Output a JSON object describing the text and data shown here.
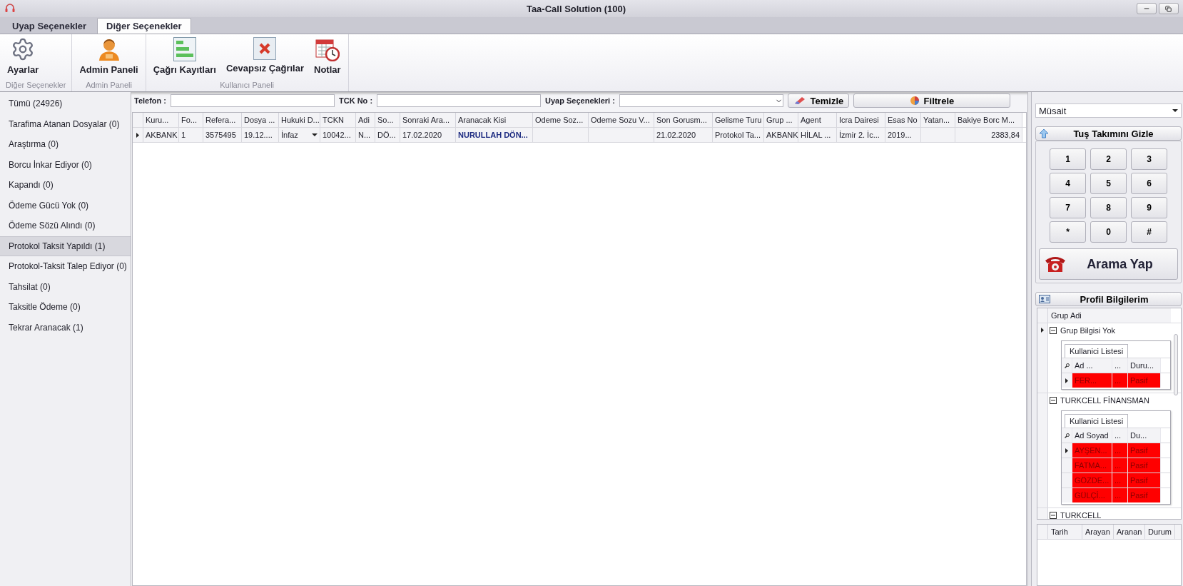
{
  "window": {
    "title": "Taa-Call Solution (100)"
  },
  "ribbon": {
    "tabs": [
      {
        "label": "Uyap Seçenekler",
        "selected": false
      },
      {
        "label": "Diğer Seçenekler",
        "selected": true
      }
    ],
    "groups": [
      {
        "label": "Diğer Seçenekler",
        "buttons": [
          {
            "label": "Ayarlar",
            "kind": "gear"
          }
        ]
      },
      {
        "label": "Admin Paneli",
        "buttons": [
          {
            "label": "Admin Paneli",
            "kind": "admin"
          }
        ]
      },
      {
        "label": "Kullanıcı Paneli",
        "buttons": [
          {
            "label": "Çağrı Kayıtları",
            "kind": "records"
          },
          {
            "label": "Cevapsız Çağrılar",
            "kind": "missed"
          },
          {
            "label": "Notlar",
            "kind": "notes"
          }
        ]
      }
    ]
  },
  "filters": {
    "fields": [
      {
        "label": "Telefon :",
        "kind": "text"
      },
      {
        "label": "TCK No :",
        "kind": "text"
      },
      {
        "label": "Uyap Seçenekleri :",
        "kind": "select"
      }
    ],
    "buttons": [
      {
        "label": "Temizle",
        "kind": "eraser"
      },
      {
        "label": "Filtrele",
        "kind": "filter"
      }
    ]
  },
  "sidebar": {
    "items": [
      {
        "label": "Tümü (24926)",
        "selected": false
      },
      {
        "label": "Tarafima Atanan Dosyalar (0)",
        "selected": false
      },
      {
        "label": "Araştırma (0)",
        "selected": false
      },
      {
        "label": "Borcu İnkar Ediyor (0)",
        "selected": false
      },
      {
        "label": "Kapandı (0)",
        "selected": false
      },
      {
        "label": "Ödeme Gücü Yok (0)",
        "selected": false
      },
      {
        "label": "Ödeme Sözü Alındı (0)",
        "selected": false
      },
      {
        "label": "Protokol Taksit Yapıldı (1)",
        "selected": true
      },
      {
        "label": "Protokol-Taksit Talep Ediyor (0)",
        "selected": false
      },
      {
        "label": "Tahsilat (0)",
        "selected": false
      },
      {
        "label": "Taksitle Ödeme (0)",
        "selected": false
      },
      {
        "label": "Tekrar Aranacak (1)",
        "selected": false
      }
    ]
  },
  "table": {
    "columns": [
      {
        "label": "Kuru...",
        "kind": "text"
      },
      {
        "label": "Fo...",
        "kind": "text"
      },
      {
        "label": "Refera...",
        "kind": "text"
      },
      {
        "label": "Dosya ...",
        "kind": "text"
      },
      {
        "label": "Hukuki D...",
        "kind": "select"
      },
      {
        "label": "TCKN",
        "kind": "text"
      },
      {
        "label": "Adi",
        "kind": "text"
      },
      {
        "label": "So...",
        "kind": "text"
      },
      {
        "label": "Sonraki Ara...",
        "kind": "text"
      },
      {
        "label": "Aranacak Kisi",
        "kind": "name"
      },
      {
        "label": "Odeme Soz...",
        "kind": "text"
      },
      {
        "label": "Odeme Sozu V...",
        "kind": "text"
      },
      {
        "label": "Son Gorusm...",
        "kind": "text"
      },
      {
        "label": "Gelisme Turu",
        "kind": "text"
      },
      {
        "label": "Grup ...",
        "kind": "text"
      },
      {
        "label": "Agent",
        "kind": "text"
      },
      {
        "label": "Icra Dairesi",
        "kind": "text"
      },
      {
        "label": "Esas No",
        "kind": "text"
      },
      {
        "label": "Yatan...",
        "kind": "text"
      },
      {
        "label": "Bakiye Borc M...",
        "kind": "number"
      }
    ],
    "rows": [
      {
        "current": true,
        "cells": [
          "AKBANK",
          "1",
          "3575495",
          "19.12....",
          "İnfaz",
          "10042...",
          "N...",
          "DÖ...",
          "17.02.2020",
          "NURULLAH DÖN...",
          "",
          "",
          "21.02.2020",
          "Protokol Ta...",
          "AKBANK",
          "HİLAL ...",
          "İzmir 2. İc...",
          "2019...",
          "",
          "2383,84"
        ]
      }
    ]
  },
  "status": {
    "value": "Müsait"
  },
  "keypad": {
    "toggle": "Tuş Takımını Gizle",
    "keys": [
      "1",
      "2",
      "3",
      "4",
      "5",
      "6",
      "7",
      "8",
      "9",
      "*",
      "0",
      "#"
    ]
  },
  "call_button": "Arama Yap",
  "profile": {
    "title": "Profil Bilgilerim",
    "column": "Grup Adi",
    "groups": [
      {
        "name": "Grup Bilgisi Yok",
        "expanded": true,
        "current": true,
        "tab": "Kullanici Listesi",
        "columns": [
          "Ad ...",
          "...",
          "Duru..."
        ],
        "users": [
          {
            "current": true,
            "color": "#ff0000",
            "cells": [
              "FER...",
              "...",
              "Pasif"
            ]
          }
        ]
      },
      {
        "name": "TURKCELL FİNANSMAN",
        "expanded": true,
        "current": false,
        "tab": "Kullanici Listesi",
        "columns": [
          "Ad Soyad",
          "...",
          "Du..."
        ],
        "users": [
          {
            "current": true,
            "color": "#ff0000",
            "cells": [
              "AYŞEN...",
              "...",
              "Pasif"
            ]
          },
          {
            "current": false,
            "color": "#ff0000",
            "cells": [
              "FATMA...",
              "...",
              "Pasif"
            ]
          },
          {
            "current": false,
            "color": "#ff0000",
            "cells": [
              "GÖZDE...",
              "...",
              "Pasif"
            ]
          },
          {
            "current": false,
            "color": "#ff0000",
            "cells": [
              "GÜLÇİ...",
              "...",
              "Pasif"
            ]
          }
        ]
      },
      {
        "name": "TURKCELL",
        "expanded": true,
        "current": false
      }
    ]
  },
  "history": {
    "columns": [
      "Tarih",
      "Arayan",
      "Aranan",
      "Durum"
    ]
  }
}
